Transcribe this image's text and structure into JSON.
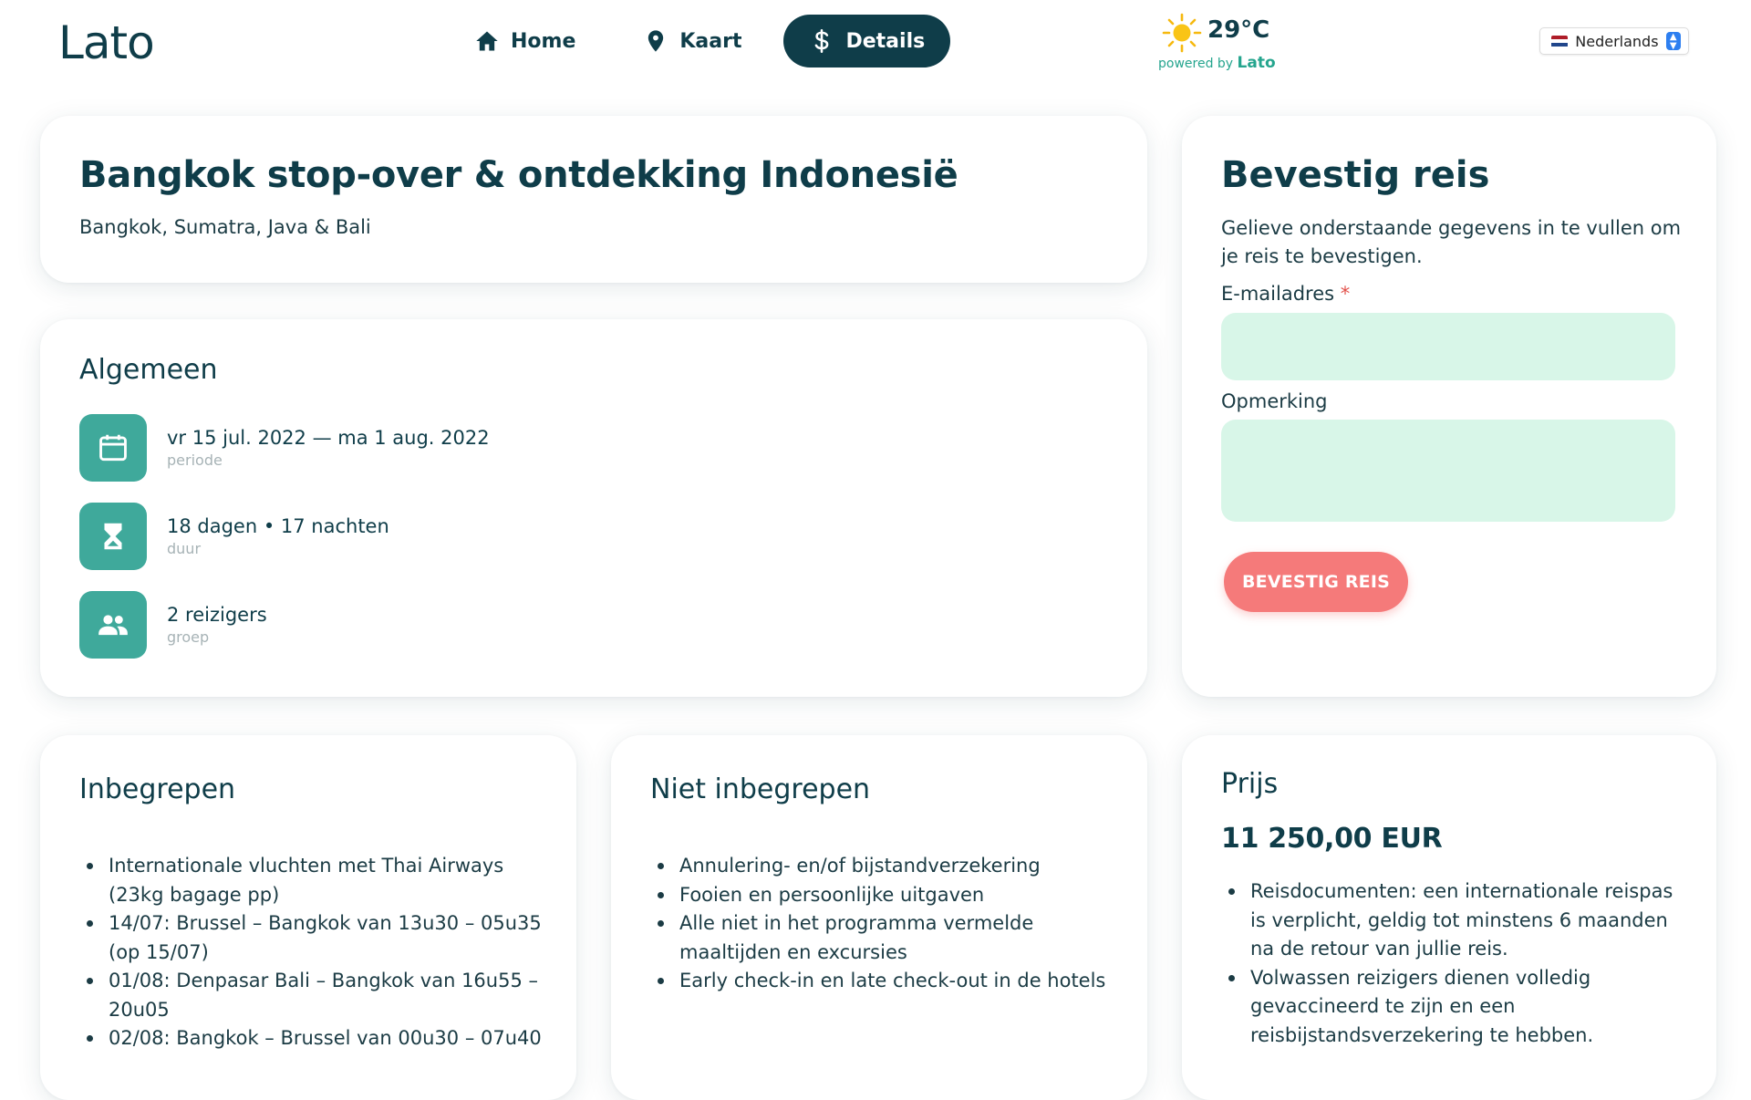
{
  "header": {
    "logo": "Lato",
    "nav": [
      {
        "label": "Home",
        "icon": "home-icon",
        "active": false
      },
      {
        "label": "Kaart",
        "icon": "map-pin-icon",
        "active": false
      },
      {
        "label": "Details",
        "icon": "dollar-icon",
        "active": true
      }
    ],
    "weather": {
      "temperature": "29°C",
      "powered_by": "powered by",
      "brand": "Lato",
      "icon": "sun-icon"
    },
    "language": {
      "selected": "Nederlands",
      "flag": "netherlands-flag-icon"
    }
  },
  "trip": {
    "title": "Bangkok stop-over & ontdekking Indonesië",
    "subtitle": "Bangkok, Sumatra, Java & Bali"
  },
  "general": {
    "heading": "Algemeen",
    "items": [
      {
        "value": "vr 15 jul. 2022 — ma 1 aug. 2022",
        "label": "periode",
        "icon": "calendar-icon"
      },
      {
        "value": "18 dagen • 17 nachten",
        "label": "duur",
        "icon": "hourglass-icon"
      },
      {
        "value": "2 reizigers",
        "label": "groep",
        "icon": "group-icon"
      }
    ]
  },
  "confirm": {
    "title": "Bevestig reis",
    "description": "Gelieve onderstaande gegevens in te vullen om je reis te bevestigen.",
    "email_label": "E-mailadres",
    "required_mark": "*",
    "email_value": "",
    "remark_label": "Opmerking",
    "remark_value": "",
    "button": "BEVESTIG REIS"
  },
  "included": {
    "heading": "Inbegrepen",
    "items": [
      "Internationale vluchten met Thai Airways (23kg bagage pp)",
      "14/07: Brussel – Bangkok van 13u30 – 05u35 (op 15/07)",
      "01/08: Denpasar Bali – Bangkok van 16u55 – 20u05",
      "02/08: Bangkok – Brussel van 00u30 – 07u40"
    ]
  },
  "excluded": {
    "heading": "Niet inbegrepen",
    "items": [
      "Annulering- en/of bijstandverzekering",
      "Fooien en persoonlijke uitgaven",
      "Alle niet in het programma vermelde maaltijden en excursies",
      "Early check-in en late check-out in de hotels"
    ]
  },
  "price": {
    "heading": "Prijs",
    "amount": "11 250,00 EUR",
    "notes": [
      "Reisdocumenten: een internationale reispas is verplicht, geldig tot minstens 6 maanden na de retour van jullie reis.",
      "Volwassen reizigers dienen volledig gevaccineerd te zijn en een reisbijstandsverzekering te hebben."
    ]
  },
  "colors": {
    "primary": "#0f3d49",
    "teal": "#3fa99b",
    "input_bg": "#d8f6e8",
    "button": "#f57a7a",
    "accent_green": "#25a58e"
  }
}
